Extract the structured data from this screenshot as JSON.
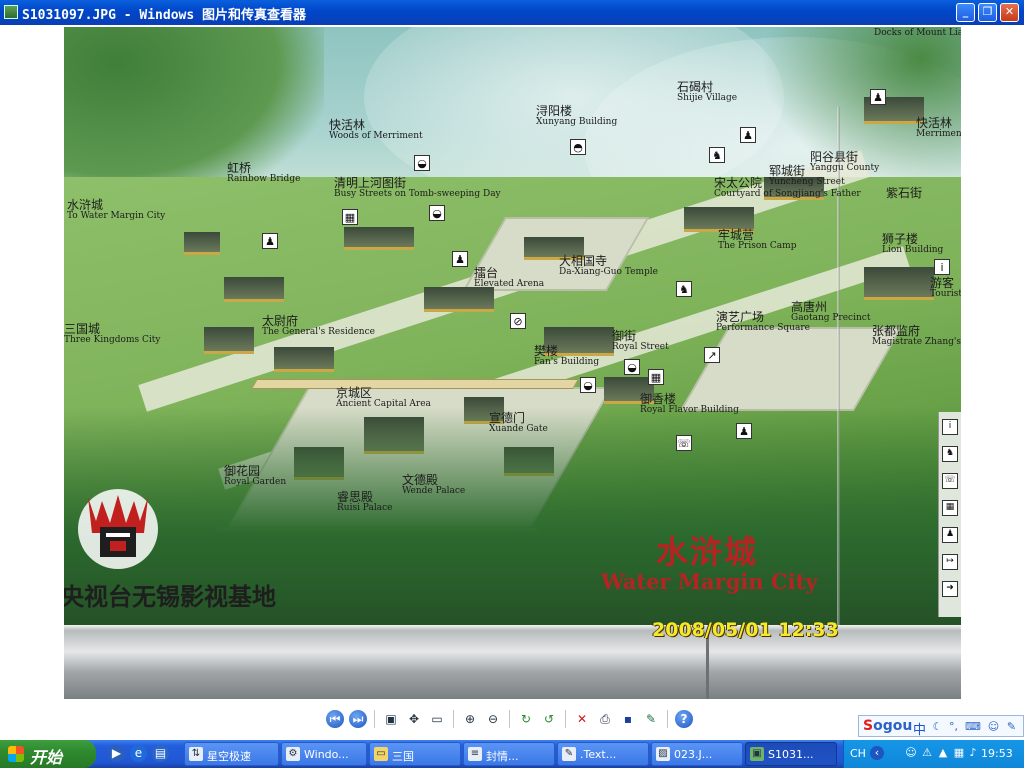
{
  "window": {
    "title": "S1031097.JPG - Windows 图片和传真查看器",
    "minimize_icon": "minimize-icon",
    "maximize_icon": "restore-icon",
    "close_icon": "close-icon"
  },
  "photo": {
    "map_labels": [
      {
        "id": "shijie",
        "zh": "石碣村",
        "en": "Shijie Village"
      },
      {
        "id": "xunyang",
        "zh": "浔阳楼",
        "en": "Xunyang Building"
      },
      {
        "id": "kuaihuolin",
        "zh": "快活林",
        "en": "Woods of Merriment"
      },
      {
        "id": "hongqiao",
        "zh": "虹桥",
        "en": "Rainbow Bridge"
      },
      {
        "id": "qingming",
        "zh": "清明上河图街",
        "en": "Busy Streets on Tomb-sweeping Day"
      },
      {
        "id": "watermargin-left",
        "zh": "水浒城",
        "en": "To Water Margin City"
      },
      {
        "id": "leitai",
        "zh": "擂台",
        "en": "Elevated Arena"
      },
      {
        "id": "daxiangguo",
        "zh": "大相国寺",
        "en": "Da-Xiang-Guo Temple"
      },
      {
        "id": "yuncheng",
        "zh": "郓城街",
        "en": "Yuncheng Street"
      },
      {
        "id": "songtaigong",
        "zh": "宋太公院",
        "en": "Courtyard of Songjiang's Father"
      },
      {
        "id": "yanggu",
        "zh": "阳谷县街",
        "en": "Yanggu County"
      },
      {
        "id": "laochengying",
        "zh": "牢城营",
        "en": "The Prison Camp"
      },
      {
        "id": "taiweifu",
        "zh": "太尉府",
        "en": "The General's Residence"
      },
      {
        "id": "sanguo",
        "zh": "三国城",
        "en": "Three Kingdoms City"
      },
      {
        "id": "yanyi",
        "zh": "演艺广场",
        "en": "Performance Square"
      },
      {
        "id": "gaotang",
        "zh": "高唐州",
        "en": "Gaotang Precinct"
      },
      {
        "id": "zhangdu",
        "zh": "张都监府",
        "en": "Magistrate Zhang's"
      },
      {
        "id": "fanlou",
        "zh": "樊楼",
        "en": "Fan's Building"
      },
      {
        "id": "yujie",
        "zh": "御街",
        "en": "Royal Street"
      },
      {
        "id": "jingcheng",
        "zh": "京城区",
        "en": "Ancient Capital Area"
      },
      {
        "id": "yuxiang",
        "zh": "御香楼",
        "en": "Royal Flavor Building"
      },
      {
        "id": "xuande",
        "zh": "宣德门",
        "en": "Xuande Gate"
      },
      {
        "id": "yuhua",
        "zh": "御花园",
        "en": "Royal Garden"
      },
      {
        "id": "wende",
        "zh": "文德殿",
        "en": "Wende Palace"
      },
      {
        "id": "ruisi",
        "zh": "睿思殿",
        "en": "Ruisi Palace"
      },
      {
        "id": "docks",
        "zh": "",
        "en": "Docks of Mount Liang"
      },
      {
        "id": "merriment-r",
        "zh": "快活林",
        "en": "Merriment"
      },
      {
        "id": "ziqiang",
        "zh": "紫石街",
        "en": ""
      },
      {
        "id": "shizilou",
        "zh": "狮子楼",
        "en": "Lion Building"
      },
      {
        "id": "tourist",
        "zh": "游客",
        "en": "Tourist"
      }
    ],
    "base_name": "央视台无锡影视基地",
    "city_name_zh": "水浒城",
    "city_name_en": "Water Margin City",
    "timestamp": "2008/05/01 12:33"
  },
  "toolbar": {
    "buttons": [
      {
        "name": "previous-image-button",
        "icon": "previous-icon",
        "glyph": "⏮"
      },
      {
        "name": "next-image-button",
        "icon": "next-icon",
        "glyph": "⏭"
      },
      {
        "name": "best-fit-button",
        "icon": "best-fit-icon",
        "glyph": "▣"
      },
      {
        "name": "actual-size-button",
        "icon": "actual-size-icon",
        "glyph": "✥"
      },
      {
        "name": "slideshow-button",
        "icon": "slideshow-icon",
        "glyph": "▭"
      },
      {
        "name": "zoom-in-button",
        "icon": "zoom-in-icon",
        "glyph": "⊕"
      },
      {
        "name": "zoom-out-button",
        "icon": "zoom-out-icon",
        "glyph": "⊖"
      },
      {
        "name": "rotate-clockwise-button",
        "icon": "rotate-cw-icon",
        "glyph": "↻"
      },
      {
        "name": "rotate-counterclockwise-button",
        "icon": "rotate-ccw-icon",
        "glyph": "↺"
      },
      {
        "name": "delete-button",
        "icon": "delete-icon",
        "glyph": "✕"
      },
      {
        "name": "print-button",
        "icon": "print-icon",
        "glyph": "⎙"
      },
      {
        "name": "save-button",
        "icon": "save-icon",
        "glyph": "▪"
      },
      {
        "name": "edit-button",
        "icon": "edit-icon",
        "glyph": "✎"
      },
      {
        "name": "help-button",
        "icon": "help-icon",
        "glyph": "?"
      }
    ]
  },
  "ime": {
    "brand_s": "S",
    "brand_rest": "ogou",
    "mode": "中",
    "icons": [
      "moon-icon",
      "punctuation-icon",
      "keyboard-icon",
      "user-icon",
      "tools-icon"
    ]
  },
  "taskbar": {
    "start_label": "开始",
    "quick_launch": [
      "media-player-icon",
      "internet-explorer-icon",
      "show-desktop-icon"
    ],
    "tasks": [
      {
        "label": "星空极速",
        "icon": "network-icon",
        "active": false
      },
      {
        "label": "Windo...",
        "icon": "gear-icon",
        "active": false
      },
      {
        "label": "三国",
        "icon": "folder-icon",
        "active": false
      },
      {
        "label": "封情...",
        "icon": "document-icon",
        "active": false
      },
      {
        "label": ".Text...",
        "icon": "notepad-icon",
        "active": false
      },
      {
        "label": "023.J...",
        "icon": "image-icon",
        "active": false
      },
      {
        "label": "S1031...",
        "icon": "image-viewer-icon",
        "active": true
      }
    ],
    "tray_lang": "CH",
    "clock": "19:53"
  },
  "colors": {
    "title_bar": "#0046c8",
    "taskbar": "#245edb",
    "start_button": "#2f8a2f",
    "city_title_red": "#b52323",
    "timestamp_yellow": "#f2ea2a"
  }
}
